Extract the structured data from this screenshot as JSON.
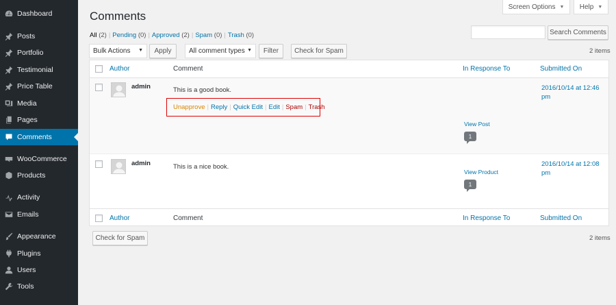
{
  "sidebar": {
    "items": [
      {
        "label": "Dashboard",
        "icon": "dashboard-icon"
      },
      {
        "label": "Posts",
        "icon": "pin-icon"
      },
      {
        "label": "Portfolio",
        "icon": "pin-icon"
      },
      {
        "label": "Testimonial",
        "icon": "pin-icon"
      },
      {
        "label": "Price Table",
        "icon": "pin-icon"
      },
      {
        "label": "Media",
        "icon": "media-icon"
      },
      {
        "label": "Pages",
        "icon": "page-icon"
      },
      {
        "label": "Comments",
        "icon": "comment-icon"
      },
      {
        "label": "WooCommerce",
        "icon": "woo-icon"
      },
      {
        "label": "Products",
        "icon": "product-icon"
      },
      {
        "label": "Activity",
        "icon": "activity-icon"
      },
      {
        "label": "Emails",
        "icon": "email-icon"
      },
      {
        "label": "Appearance",
        "icon": "brush-icon"
      },
      {
        "label": "Plugins",
        "icon": "plugin-icon"
      },
      {
        "label": "Users",
        "icon": "user-icon"
      },
      {
        "label": "Tools",
        "icon": "wrench-icon"
      }
    ],
    "current": "Comments"
  },
  "header": {
    "screen_options": "Screen Options",
    "help": "Help",
    "title": "Comments"
  },
  "status_filters": {
    "all_label": "All",
    "all_count": "(2)",
    "pending_label": "Pending",
    "pending_count": "(0)",
    "approved_label": "Approved",
    "approved_count": "(2)",
    "spam_label": "Spam",
    "spam_count": "(0)",
    "trash_label": "Trash",
    "trash_count": "(0)",
    "separator": "|"
  },
  "search": {
    "value": "",
    "button": "Search Comments"
  },
  "top_nav": {
    "bulk_actions": "Bulk Actions",
    "apply": "Apply",
    "comment_types": "All comment types",
    "filter": "Filter",
    "check_spam": "Check for Spam",
    "items": "2 items"
  },
  "bottom_nav": {
    "check_spam": "Check for Spam",
    "items": "2 items"
  },
  "columns": {
    "author": "Author",
    "comment": "Comment",
    "response": "In Response To",
    "submitted": "Submitted On"
  },
  "comments": [
    {
      "author": "admin",
      "text": "This is a good book.",
      "actions": {
        "unapprove": "Unapprove",
        "reply": "Reply",
        "quick_edit": "Quick Edit",
        "edit": "Edit",
        "spam": "Spam",
        "trash": "Trash",
        "separator": "|"
      },
      "response_link": "View Post",
      "comment_count": "1",
      "submitted_line1": "2016/10/14 at 12:46",
      "submitted_line2": "pm"
    },
    {
      "author": "admin",
      "text": "This is a nice book.",
      "response_link": "View Product",
      "comment_count": "1",
      "submitted_line1": "2016/10/14 at 12:08",
      "submitted_line2": "pm"
    }
  ],
  "colors": {
    "sidebar_bg": "#23282d",
    "accent": "#0073aa",
    "unapprove": "#d98500",
    "danger": "#a00",
    "highlight_border": "#d00"
  }
}
